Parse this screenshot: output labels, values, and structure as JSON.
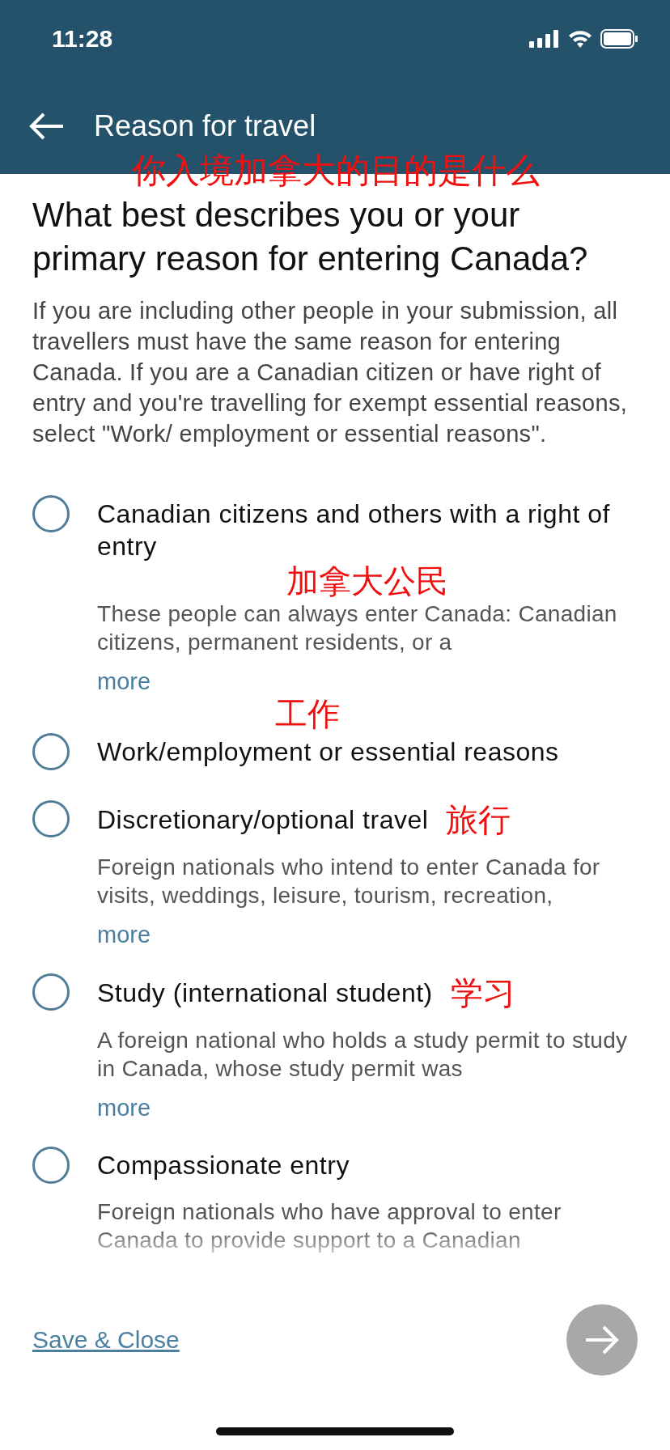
{
  "status_bar": {
    "time": "11:28"
  },
  "header": {
    "title": "Reason for travel",
    "annotation": "你入境加拿大的目的是什么"
  },
  "question": {
    "heading": "What best describes you or your primary reason for entering Canada?",
    "help": "If you are including other people in your submission, all travellers must have the same reason for entering Canada. If you are a Canadian citizen or have right of entry and you're travelling for exempt essential reasons, select \"Work/ employment or essential reasons\"."
  },
  "options": [
    {
      "label": "Canadian citizens and others with a right of entry",
      "description": "These people can always enter Canada: Canadian citizens, permanent residents, or a",
      "more": "more",
      "selected": false,
      "annotation": {
        "text": "加拿大公民",
        "kind": "under-label"
      },
      "trailing_annotation": "工作"
    },
    {
      "label": "Work/employment or essential reasons",
      "selected": false
    },
    {
      "label": "Discretionary/optional travel",
      "description": "Foreign nationals who intend to enter Canada for visits, weddings, leisure, tourism, recreation,",
      "more": "more",
      "selected": false,
      "annotation": {
        "text": "旅行",
        "kind": "beside-label"
      }
    },
    {
      "label": "Study (international student)",
      "description": "A foreign national who holds a study permit to study in Canada, whose study permit was",
      "more": "more",
      "selected": false,
      "annotation": {
        "text": "学习",
        "kind": "beside-label"
      }
    },
    {
      "label": "Compassionate entry",
      "description": "Foreign nationals who have approval to enter Canada to provide support to a Canadian",
      "selected": false
    }
  ],
  "footer": {
    "save_link": "Save & Close",
    "next_disabled": true
  }
}
